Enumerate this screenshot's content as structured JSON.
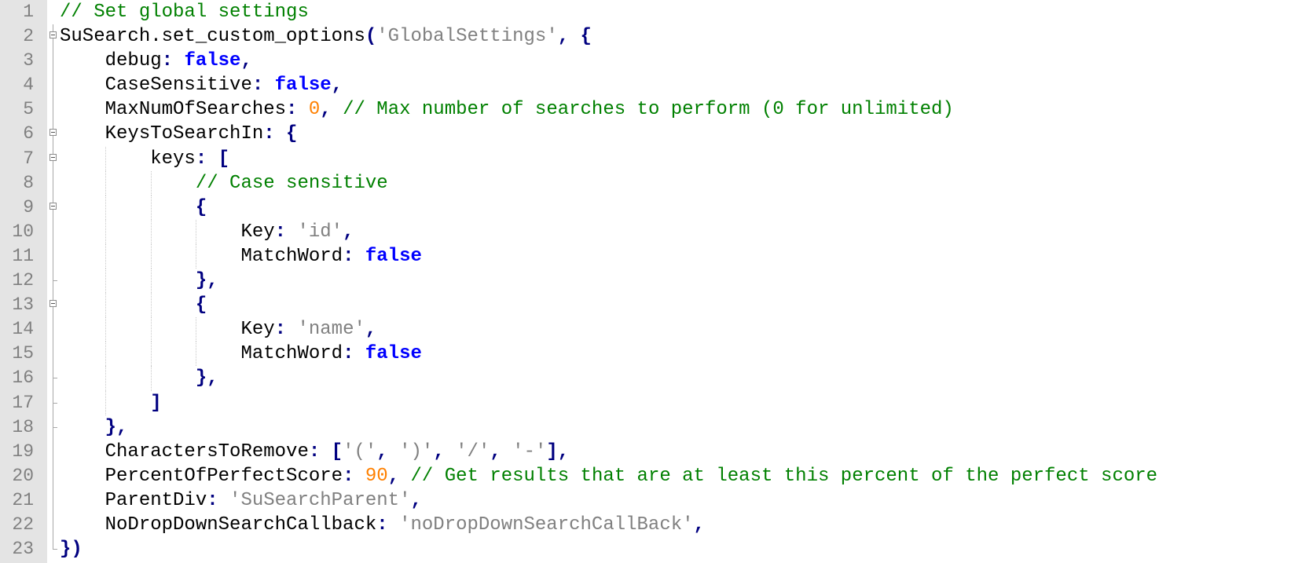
{
  "editor": {
    "language": "javascript",
    "colors": {
      "comment": "#008000",
      "keyword": "#0000ff",
      "number": "#ff8000",
      "string": "#808080",
      "operator": "#000080",
      "identifier": "#000000",
      "line_number": "#808080",
      "gutter_background": "#e4e4e4"
    },
    "lines": [
      {
        "n": "1",
        "fold": "none",
        "indent": 0,
        "tokens": [
          [
            "comment",
            "// Set global settings"
          ]
        ]
      },
      {
        "n": "2",
        "fold": "open",
        "indent": 0,
        "tokens": [
          [
            "ident",
            "SuSearch.set_custom_options"
          ],
          [
            "op",
            "("
          ],
          [
            "string",
            "'GlobalSettings'"
          ],
          [
            "op",
            ", {"
          ]
        ]
      },
      {
        "n": "3",
        "fold": "line",
        "indent": 1,
        "tokens": [
          [
            "ident",
            "    debug"
          ],
          [
            "op",
            ": "
          ],
          [
            "keyword",
            "false"
          ],
          [
            "op",
            ","
          ]
        ]
      },
      {
        "n": "4",
        "fold": "line",
        "indent": 1,
        "tokens": [
          [
            "ident",
            "    CaseSensitive"
          ],
          [
            "op",
            ": "
          ],
          [
            "keyword",
            "false"
          ],
          [
            "op",
            ","
          ]
        ]
      },
      {
        "n": "5",
        "fold": "line",
        "indent": 1,
        "tokens": [
          [
            "ident",
            "    MaxNumOfSearches"
          ],
          [
            "op",
            ": "
          ],
          [
            "number",
            "0"
          ],
          [
            "op",
            ", "
          ],
          [
            "comment",
            "// Max number of searches to perform (0 for unlimited)"
          ]
        ]
      },
      {
        "n": "6",
        "fold": "open",
        "indent": 1,
        "tokens": [
          [
            "ident",
            "    KeysToSearchIn"
          ],
          [
            "op",
            ": {"
          ]
        ]
      },
      {
        "n": "7",
        "fold": "open",
        "indent": 2,
        "tokens": [
          [
            "ident",
            "        keys"
          ],
          [
            "op",
            ": ["
          ]
        ]
      },
      {
        "n": "8",
        "fold": "line",
        "indent": 3,
        "tokens": [
          [
            "ident",
            "            "
          ],
          [
            "comment",
            "// Case sensitive"
          ]
        ]
      },
      {
        "n": "9",
        "fold": "open",
        "indent": 3,
        "tokens": [
          [
            "ident",
            "            "
          ],
          [
            "op",
            "{"
          ]
        ]
      },
      {
        "n": "10",
        "fold": "line",
        "indent": 4,
        "tokens": [
          [
            "ident",
            "                Key"
          ],
          [
            "op",
            ": "
          ],
          [
            "string",
            "'id'"
          ],
          [
            "op",
            ","
          ]
        ]
      },
      {
        "n": "11",
        "fold": "line",
        "indent": 4,
        "tokens": [
          [
            "ident",
            "                MatchWord"
          ],
          [
            "op",
            ": "
          ],
          [
            "keyword",
            "false"
          ]
        ]
      },
      {
        "n": "12",
        "fold": "end",
        "indent": 3,
        "tokens": [
          [
            "ident",
            "            "
          ],
          [
            "op",
            "},"
          ]
        ]
      },
      {
        "n": "13",
        "fold": "open",
        "indent": 3,
        "tokens": [
          [
            "ident",
            "            "
          ],
          [
            "op",
            "{"
          ]
        ]
      },
      {
        "n": "14",
        "fold": "line",
        "indent": 4,
        "tokens": [
          [
            "ident",
            "                Key"
          ],
          [
            "op",
            ": "
          ],
          [
            "string",
            "'name'"
          ],
          [
            "op",
            ","
          ]
        ]
      },
      {
        "n": "15",
        "fold": "line",
        "indent": 4,
        "tokens": [
          [
            "ident",
            "                MatchWord"
          ],
          [
            "op",
            ": "
          ],
          [
            "keyword",
            "false"
          ]
        ]
      },
      {
        "n": "16",
        "fold": "end",
        "indent": 3,
        "tokens": [
          [
            "ident",
            "            "
          ],
          [
            "op",
            "},"
          ]
        ]
      },
      {
        "n": "17",
        "fold": "end",
        "indent": 2,
        "tokens": [
          [
            "ident",
            "        "
          ],
          [
            "op",
            "]"
          ]
        ]
      },
      {
        "n": "18",
        "fold": "end",
        "indent": 1,
        "tokens": [
          [
            "ident",
            "    "
          ],
          [
            "op",
            "},"
          ]
        ]
      },
      {
        "n": "19",
        "fold": "line",
        "indent": 1,
        "tokens": [
          [
            "ident",
            "    CharactersToRemove"
          ],
          [
            "op",
            ": ["
          ],
          [
            "string",
            "'('"
          ],
          [
            "op",
            ", "
          ],
          [
            "string",
            "')'"
          ],
          [
            "op",
            ", "
          ],
          [
            "string",
            "'/'"
          ],
          [
            "op",
            ", "
          ],
          [
            "string",
            "'-'"
          ],
          [
            "op",
            "],"
          ]
        ]
      },
      {
        "n": "20",
        "fold": "line",
        "indent": 1,
        "tokens": [
          [
            "ident",
            "    PercentOfPerfectScore"
          ],
          [
            "op",
            ": "
          ],
          [
            "number",
            "90"
          ],
          [
            "op",
            ", "
          ],
          [
            "comment",
            "// Get results that are at least this percent of the perfect score"
          ]
        ]
      },
      {
        "n": "21",
        "fold": "line",
        "indent": 1,
        "tokens": [
          [
            "ident",
            "    ParentDiv"
          ],
          [
            "op",
            ": "
          ],
          [
            "string",
            "'SuSearchParent'"
          ],
          [
            "op",
            ","
          ]
        ]
      },
      {
        "n": "22",
        "fold": "line",
        "indent": 1,
        "tokens": [
          [
            "ident",
            "    NoDropDownSearchCallback"
          ],
          [
            "op",
            ": "
          ],
          [
            "string",
            "'noDropDownSearchCallBack'"
          ],
          [
            "op",
            ","
          ]
        ]
      },
      {
        "n": "23",
        "fold": "end",
        "indent": 0,
        "tokens": [
          [
            "op",
            "})"
          ]
        ]
      }
    ]
  }
}
